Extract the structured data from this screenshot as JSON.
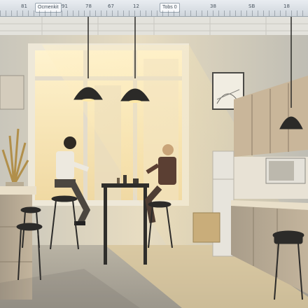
{
  "ruler": {
    "labels": [
      "81",
      "Ocmenkit",
      "91",
      "78",
      "67",
      "12",
      "38",
      "SB",
      "18"
    ],
    "box_left": "Ocmenkit",
    "box_right": "Tobs 0"
  },
  "colors": {
    "wall": "#d8d3c5",
    "sunlight": "#f4d58a",
    "cabinet": "#b8a78f",
    "floor": "#cfc2a8",
    "lamp": "#2b2a28"
  },
  "icons": [
    "lamp-icon",
    "plant-icon",
    "microwave-icon",
    "fridge-icon",
    "stool-icon"
  ]
}
